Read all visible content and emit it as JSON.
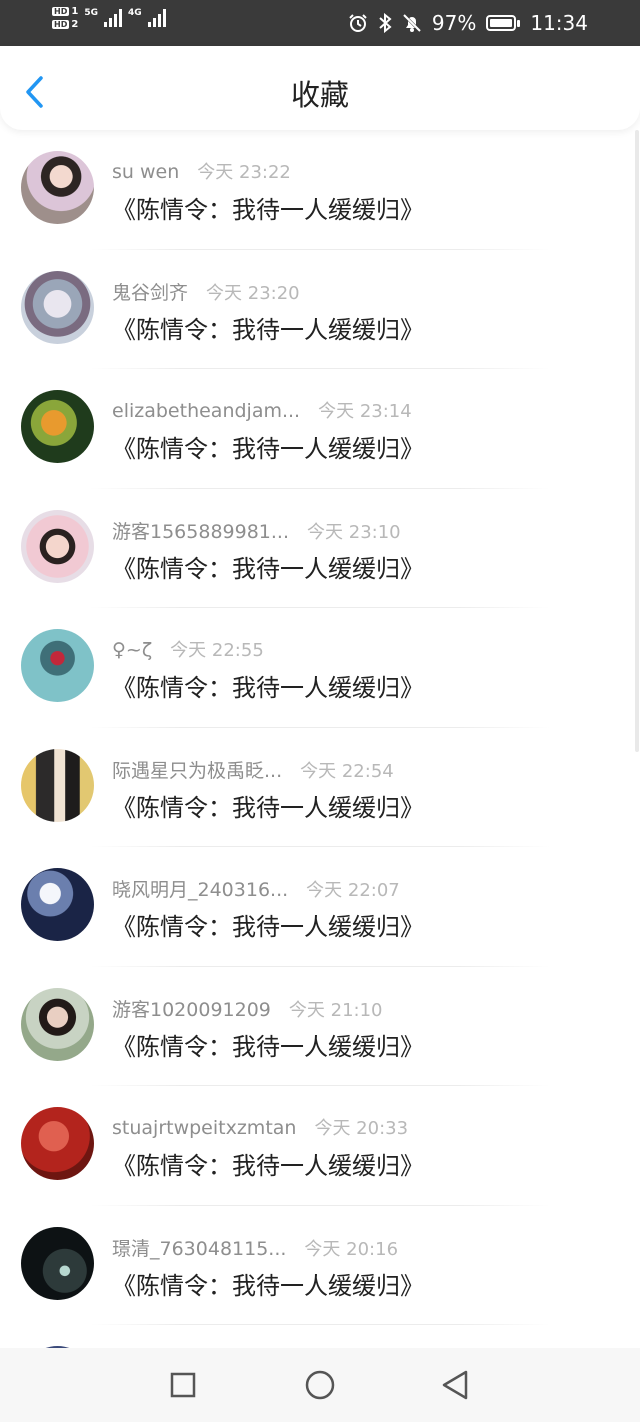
{
  "status_bar": {
    "hd1": "HD",
    "hd1_num": "1",
    "hd2": "HD",
    "hd2_num": "2",
    "net1": "5G",
    "net2": "4G",
    "battery": "97%",
    "time": "11:34",
    "icons": [
      "alarm-icon",
      "bluetooth-icon",
      "mute-bell-icon",
      "battery-icon"
    ]
  },
  "header": {
    "title": "收藏",
    "back_icon": "chevron-left-icon",
    "accent_color": "#2196F3"
  },
  "items": [
    {
      "username": "su wen",
      "time": "今天 23:22",
      "title": "《陈情令：我待一人缓缓归》",
      "avatar": {
        "bg": "radial-gradient(circle at 55% 35%, #f3d9cf 0 18%, #2d2523 19% 32%, #dcc5d8 33% 55%, #9e8f8b 56%)"
      }
    },
    {
      "username": "鬼谷剑齐",
      "time": "今天 23:20",
      "title": "《陈情令：我待一人缓缓归》",
      "avatar": {
        "bg": "radial-gradient(circle at 50% 45%, #e9e6ef 0 25%, #9aa6b8 26% 45%, #7a6b80 46% 60%, #c8d0dc 61%)"
      }
    },
    {
      "username": "elizabetheandjam...",
      "time": "今天 23:14",
      "title": "《陈情令：我待一人缓缓归》",
      "avatar": {
        "bg": "radial-gradient(circle at 45% 45%, #e89a2e 0 22%, #8aa63a 23% 40%, #1f3b1c 41%)"
      }
    },
    {
      "username": "游客1565889981...",
      "time": "今天 23:10",
      "title": "《陈情令：我待一人缓缓归》",
      "avatar": {
        "bg": "radial-gradient(circle at 50% 50%, #f4d6cc 0 22%, #2a2220 23% 34%, #f1c9d3 35% 60%, #e7dde6 61%)"
      }
    },
    {
      "username": "♀~ζ",
      "time": "今天 22:55",
      "title": "《陈情令：我待一人缓缓归》",
      "avatar": {
        "bg": "radial-gradient(circle at 50% 40%, #c2283a 0 12%, #3f6f78 13% 30%, #7fc2c8 31%)"
      }
    },
    {
      "username": "际遇星只为极禹眨...",
      "time": "今天 22:54",
      "title": "《陈情令：我待一人缓缓归》",
      "avatar": {
        "bg": "linear-gradient(90deg, #e6c66a 0 20%, #2c2a2a 21% 45%, #f0e3d3 46% 60%, #1e1c1c 61% 80%, #e2c871 81%)"
      }
    },
    {
      "username": "晓风明月_240316...",
      "time": "今天 22:07",
      "title": "《陈情令：我待一人缓缓归》",
      "avatar": {
        "bg": "radial-gradient(circle at 40% 35%, #f4f6fb 0 16%, #6b7fae 17% 35%, #1a2446 36%)"
      }
    },
    {
      "username": "游客1020091209",
      "time": "今天 21:10",
      "title": "《陈情令：我待一人缓缓归》",
      "avatar": {
        "bg": "radial-gradient(circle at 50% 40%, #e9cfc2 0 18%, #221a18 19% 32%, #c8d3c3 33% 55%, #94a88a 56%)"
      }
    },
    {
      "username": "stuajrtwpeitxzmtan",
      "time": "今天 20:33",
      "title": "《陈情令：我待一人缓缓归》",
      "avatar": {
        "bg": "radial-gradient(circle at 45% 40%, #e06050 0 25%, #b3241d 26% 60%, #6e1611 61%)"
      }
    },
    {
      "username": "璟清_763048115...",
      "time": "今天 20:16",
      "title": "《陈情令：我待一人缓缓归》",
      "avatar": {
        "bg": "radial-gradient(circle at 60% 60%, #b7d8d0 0 8%, #2d3a3a 9% 35%, #0d1214 36%)"
      }
    }
  ],
  "nav_bar": {
    "icons": [
      "recent-apps-icon",
      "home-icon",
      "back-triangle-icon"
    ]
  }
}
